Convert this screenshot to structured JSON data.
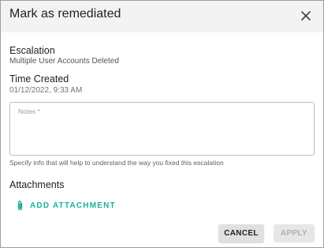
{
  "dialog": {
    "title": "Mark as remediated",
    "close_icon": "close-icon"
  },
  "escalation": {
    "label": "Escalation",
    "value": "Multiple User Accounts Deleted"
  },
  "time_created": {
    "label": "Time Created",
    "value": "01/12/2022, 9:33 AM"
  },
  "notes": {
    "placeholder": "Notes *",
    "value": "",
    "helper": "Specify info that will help to understand the way you fixed this escalation"
  },
  "attachments": {
    "label": "Attachments",
    "add_label": "ADD ATTACHMENT",
    "icon": "paperclip-icon"
  },
  "actions": {
    "cancel_label": "CANCEL",
    "apply_label": "APPLY",
    "apply_disabled": true
  },
  "colors": {
    "accent": "#1ab394",
    "header_bg": "#f3f3f3",
    "cancel_bg": "#e0e0e0",
    "apply_disabled_bg": "#e6e6e6"
  }
}
